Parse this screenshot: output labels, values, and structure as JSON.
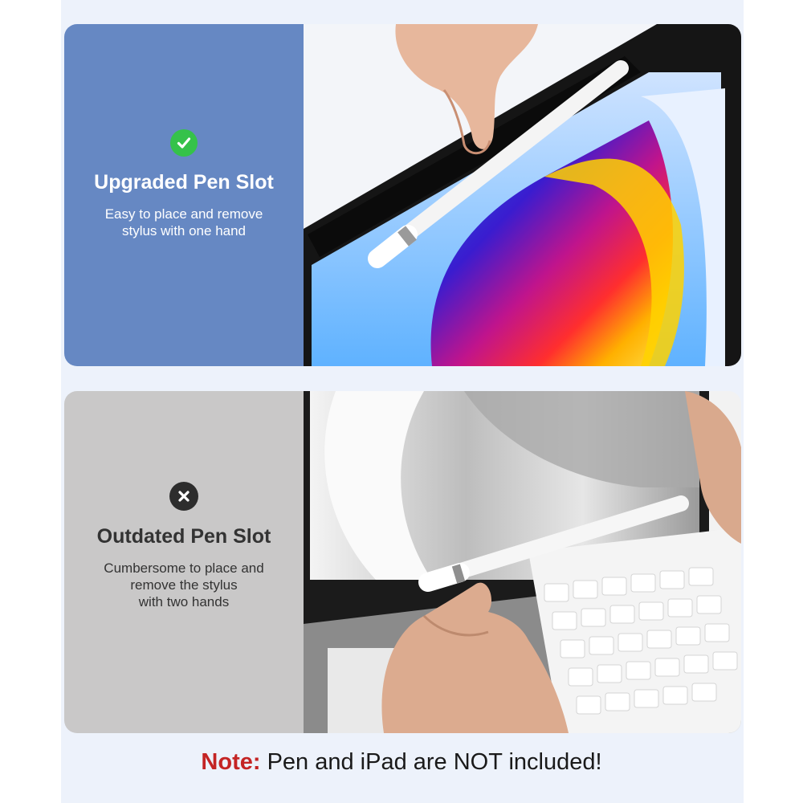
{
  "colors": {
    "page_background": "#edf2fb",
    "upgraded_panel": "#6688c3",
    "outdated_panel": "#c9c8c8",
    "check_badge": "#35c24a",
    "x_badge": "#2d2d2d",
    "note_label": "#c42424"
  },
  "upgraded": {
    "icon": "check-circle-icon",
    "title": "Upgraded Pen Slot",
    "description_lines": [
      "Easy to place and remove",
      "stylus with one hand"
    ]
  },
  "outdated": {
    "icon": "x-circle-icon",
    "title": "Outdated Pen Slot",
    "description_lines": [
      "Cumbersome to place and",
      "remove the stylus",
      "with two hands"
    ]
  },
  "note": {
    "label": "Note:",
    "text": " Pen and iPad are NOT included!"
  }
}
